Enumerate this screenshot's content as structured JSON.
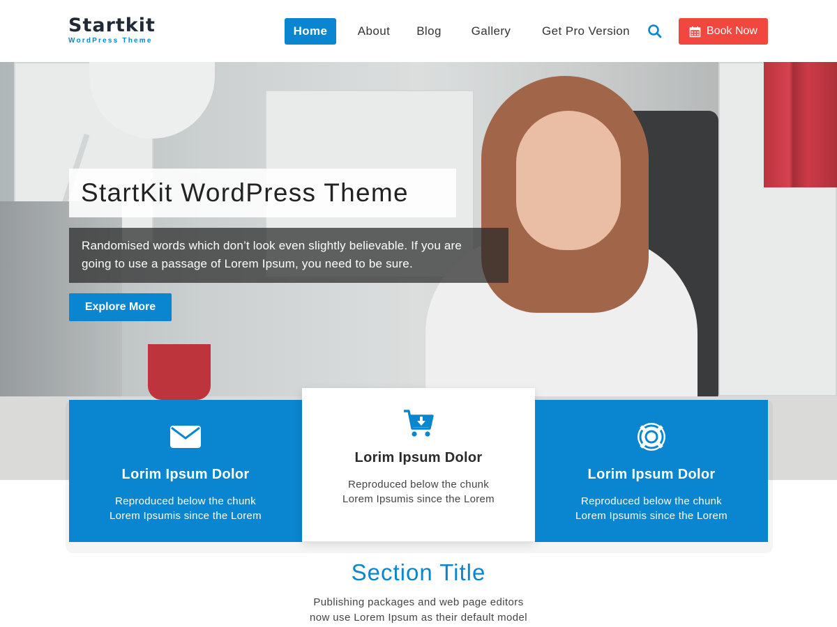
{
  "brand": {
    "name": "Startkit",
    "tagline": "WordPress Theme"
  },
  "nav": {
    "items": [
      {
        "label": "Home",
        "active": true
      },
      {
        "label": "About",
        "active": false
      },
      {
        "label": "Blog",
        "active": false
      },
      {
        "label": "Gallery",
        "active": false
      },
      {
        "label": "Get Pro Version",
        "active": false
      }
    ],
    "search_icon": "search-icon",
    "book_button": {
      "label": "Book Now",
      "icon": "calendar-icon"
    }
  },
  "hero": {
    "title": "StartKit WordPress Theme",
    "description_line1": "Randomised words which don’t look even slightly believable. If you are",
    "description_line2": "going to use a passage of Lorem Ipsum, you need to be sure.",
    "button_label": "Explore More"
  },
  "features": [
    {
      "icon": "envelope-icon",
      "title": "Lorim Ipsum Dolor",
      "line1": "Reproduced below the chunk",
      "line2": "Lorem Ipsumis since the Lorem"
    },
    {
      "icon": "cart-icon",
      "title": "Lorim Ipsum Dolor",
      "line1": "Reproduced below the chunk",
      "line2": "Lorem Ipsumis since the Lorem"
    },
    {
      "icon": "lifebuoy-icon",
      "title": "Lorim Ipsum Dolor",
      "line1": "Reproduced below the chunk",
      "line2": "Lorem Ipsumis since the Lorem"
    }
  ],
  "section": {
    "title": "Section Title",
    "line1": "Publishing packages and web page editors",
    "line2": "now use Lorem Ipsum as their default model"
  },
  "colors": {
    "accent": "#0a86d0",
    "book": "#f2473f",
    "dark": "#1f2a36"
  }
}
